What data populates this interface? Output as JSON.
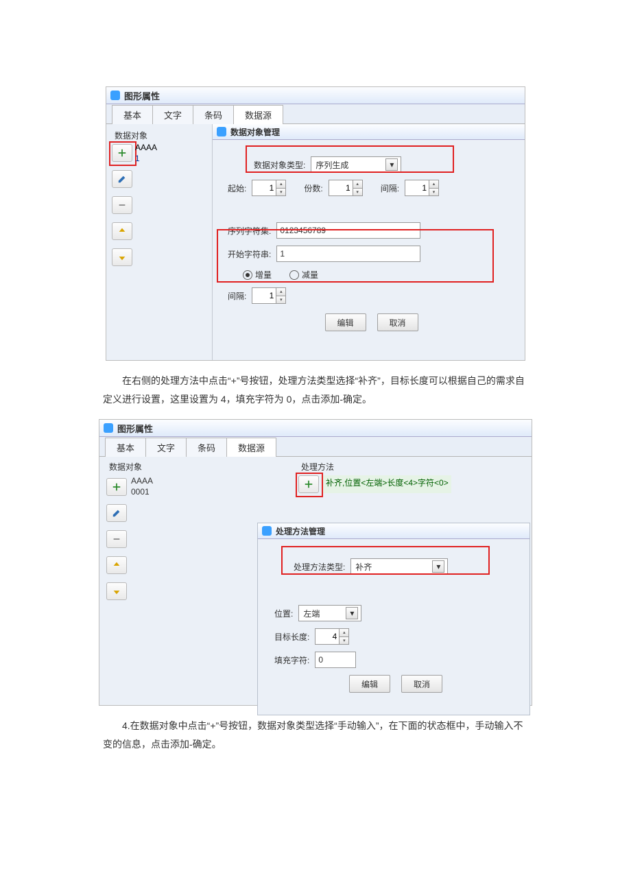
{
  "fig1": {
    "windowTitle": "图形属性",
    "tabs": [
      "基本",
      "文字",
      "条码",
      "数据源"
    ],
    "activeTab": "数据源",
    "leftGroupTitle": "数据对象",
    "itemLine1": "AAAA",
    "itemLine2": "1",
    "sub": {
      "title": "数据对象管理",
      "typeLabel": "数据对象类型:",
      "typeValue": "序列生成",
      "startLabel": "起始:",
      "startValue": "1",
      "countLabel": "份数:",
      "countValue": "1",
      "gapLabel": "间隔:",
      "gapValue": "1",
      "charsetLabel": "序列字符集:",
      "charsetValue": "0123456789",
      "startStrLabel": "开始字符串:",
      "startStrValue": "1",
      "incLabel": "增量",
      "decLabel": "减量",
      "intervalLabel": "间隔:",
      "intervalValue": "1",
      "editBtn": "编辑",
      "cancelBtn": "取消"
    }
  },
  "para1": "在右侧的处理方法中点击“+”号按钮，处理方法类型选择“补齐”，目标长度可以根据自己的需求自定义进行设置，这里设置为 4，填充字符为 0，点击添加-确定。",
  "fig2": {
    "windowTitle": "图形属性",
    "tabs": [
      "基本",
      "文字",
      "条码",
      "数据源"
    ],
    "activeTab": "数据源",
    "leftGroupTitle": "数据对象",
    "rightGroupTitle": "处理方法",
    "itemLine1": "AAAA",
    "itemLine2": "0001",
    "methodItem": "补齐,位置<左端>长度<4>字符<0>",
    "sub": {
      "title": "处理方法管理",
      "typeLabel": "处理方法类型:",
      "typeValue": "补齐",
      "posLabel": "位置:",
      "posValue": "左端",
      "lenLabel": "目标长度:",
      "lenValue": "4",
      "fillLabel": "填充字符:",
      "fillValue": "0",
      "editBtn": "编辑",
      "cancelBtn": "取消"
    }
  },
  "para2": "4.在数据对象中点击“+”号按钮，数据对象类型选择“手动输入”，在下面的状态框中，手动输入不变的信息，点击添加-确定。"
}
